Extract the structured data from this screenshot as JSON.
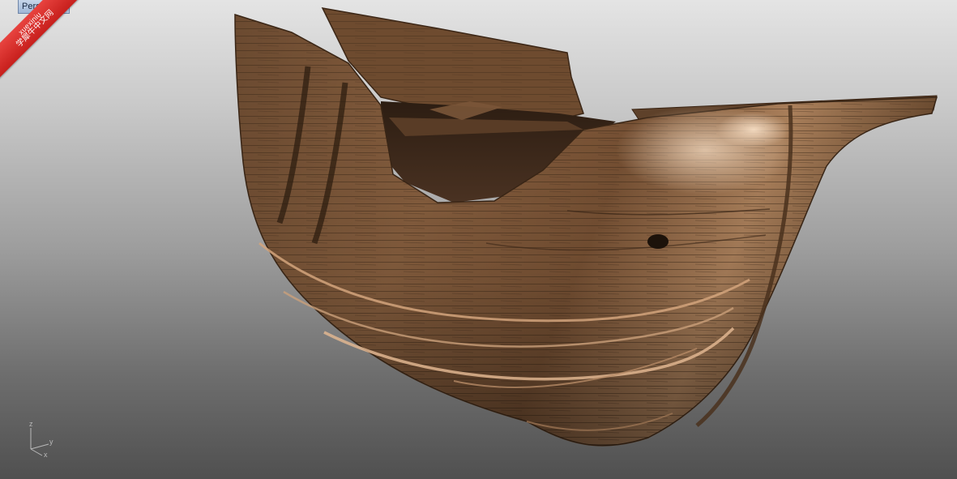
{
  "viewport": {
    "title": "Perspective",
    "background_top": "#e4e4e4",
    "background_bottom": "#505050"
  },
  "watermark": {
    "line1": "xuexiniu",
    "line2": "学犀牛中文网",
    "color": "#d8312e"
  },
  "axis_gizmo": {
    "z_label": "z",
    "y_label": "y",
    "x_label": "x"
  },
  "model": {
    "description_icon": "wooden-ship-hull",
    "wood_color": "#7a5334"
  }
}
